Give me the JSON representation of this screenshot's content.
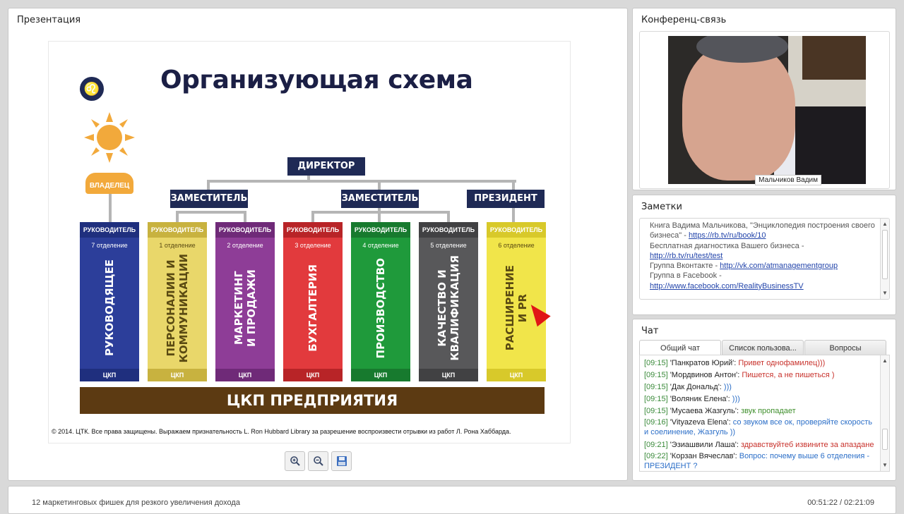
{
  "presentation": {
    "title": "Презентация",
    "slide": {
      "heading": "Организующая схема",
      "owner": "ВЛАДЕЛЕЦ",
      "director": "ДИРЕКТОР",
      "deputy_1": "ЗАМЕСТИТЕЛЬ",
      "deputy_2": "ЗАМЕСТИТЕЛЬ",
      "president": "ПРЕЗИДЕНТ",
      "divisions": [
        {
          "head": "РУКОВОДИТЕЛЬ",
          "dept": "7 отделение",
          "name": "РУКОВОДЯЩЕЕ",
          "foot": "ЦКП",
          "color": "#2c3e9a",
          "dark": "#1f2f7e",
          "text_color": "#ffffff"
        },
        {
          "head": "РУКОВОДИТЕЛЬ",
          "dept": "1 отделение",
          "name": "ПЕРСОНАЛИИ И\nКОММУНИКАЦИИ",
          "foot": "ЦКП",
          "color": "#e9d76a",
          "dark": "#c8b23f",
          "text_color": "#5a4a12"
        },
        {
          "head": "РУКОВОДИТЕЛЬ",
          "dept": "2 отделение",
          "name": "МАРКЕТИНГ\nИ ПРОДАЖИ",
          "foot": "ЦКП",
          "color": "#8e3d97",
          "dark": "#6f2a78",
          "text_color": "#ffffff"
        },
        {
          "head": "РУКОВОДИТЕЛЬ",
          "dept": "3 отделение",
          "name": "БУХГАЛТЕРИЯ",
          "foot": "ЦКП",
          "color": "#e23a3d",
          "dark": "#b82427",
          "text_color": "#ffffff"
        },
        {
          "head": "РУКОВОДИТЕЛЬ",
          "dept": "4 отделение",
          "name": "ПРОИЗВОДСТВО",
          "foot": "ЦКП",
          "color": "#1f9a3b",
          "dark": "#177a2e",
          "text_color": "#ffffff"
        },
        {
          "head": "РУКОВОДИТЕЛЬ",
          "dept": "5 отделение",
          "name": "КАЧЕСТВО И\nКВАЛИФИКАЦИЯ",
          "foot": "ЦКП",
          "color": "#58585a",
          "dark": "#414143",
          "text_color": "#ffffff"
        },
        {
          "head": "РУКОВОДИТЕЛЬ",
          "dept": "6 отделение",
          "name": "РАСШИРЕНИЕ\nИ PR",
          "foot": "ЦКП",
          "color": "#f1e54a",
          "dark": "#d8c92a",
          "text_color": "#5a4a12"
        }
      ],
      "bottom_bar": "ЦКП ПРЕДПРИЯТИЯ",
      "copyright": "© 2014. ЦТК. Все права защищены. Выражаем признательность L. Ron Hubbard Library за разрешение воспроизвести отрывки из работ Л. Рона Хаббарда."
    },
    "toolbar": {
      "zoom_in_icon": "zoom-in-icon",
      "zoom_out_icon": "zoom-out-icon",
      "save_icon": "floppy-disk-icon"
    }
  },
  "video": {
    "title": "Конференц-связь",
    "speaker_name": "Мальчиков Вадим"
  },
  "notes": {
    "title": "Заметки",
    "lines": [
      {
        "text": "Книга Вадима Мальчикова,  \"Энциклопедия построения своего бизнеса\" - ",
        "link": "https://rb.tv/ru/book/10"
      },
      {
        "text": "Бесплатная диагностика Вашего бизнеса - ",
        "link": "http://rb.tv/ru/test/test"
      },
      {
        "text": "Группа Вконтакте - ",
        "link": "http://vk.com/atmanagementgroup"
      },
      {
        "text": "Группа в Facebook - ",
        "link": "http://www.facebook.com/RealityBusinessTV"
      }
    ]
  },
  "chat": {
    "title": "Чат",
    "tabs": [
      "Общий чат",
      "Список пользова...",
      "Вопросы"
    ],
    "messages": [
      {
        "time": "[09:15]",
        "user": "'Панкратов Юрий'",
        "text": "Привет однофамилец)))",
        "color": "red"
      },
      {
        "time": "[09:15]",
        "user": "'Мордвинов Антон'",
        "text": "Пишется, а не пишеться )",
        "color": "red"
      },
      {
        "time": "[09:15]",
        "user": "'Дак Дональд'",
        "text": ")))",
        "color": "blue"
      },
      {
        "time": "[09:15]",
        "user": "'Воляник Елена'",
        "text": ")))",
        "color": "blue"
      },
      {
        "time": "[09:15]",
        "user": "'Мусаева Жазгуль'",
        "text": "звук пропадает",
        "color": "green"
      },
      {
        "time": "[09:16]",
        "user": "'Vityazeva Elena'",
        "text": "со звуком все ок, проверяйте скорость и соелинение, Жазгуль ))",
        "color": "blue"
      },
      {
        "time": "[09:21]",
        "user": "'Эзиашвили Лаша'",
        "text": "здравствуйтеб извините за апаздане",
        "color": "red"
      },
      {
        "time": "[09:22]",
        "user": "'Корзан Вячеслав'",
        "text": "Вопрос: почему выше 6 отделения - ПРЕЗИДЕНТ ?",
        "color": "blue"
      }
    ]
  },
  "footer": {
    "title": "12 маркетинговых фишек для резкого увеличения дохода",
    "time": "00:51:22 / 02:21:09"
  }
}
